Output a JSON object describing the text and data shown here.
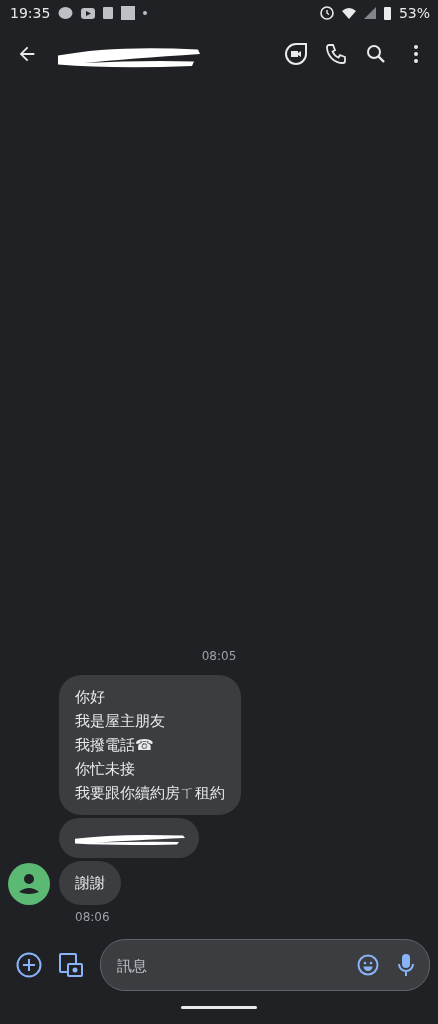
{
  "status_bar": {
    "time": "19:35",
    "battery": "53%"
  },
  "app_bar": {
    "title_redacted": true
  },
  "timestamp_top": "08:05",
  "messages": [
    {
      "kind": "text",
      "lines": [
        "你好",
        "我是屋主朋友",
        "我撥電話☎",
        "你忙未接",
        "我要跟你續約房ㄒ租約"
      ]
    },
    {
      "kind": "redacted"
    },
    {
      "kind": "text",
      "lines": [
        "謝謝"
      ],
      "avatar": true
    }
  ],
  "timestamp_bottom": "08:06",
  "composer": {
    "placeholder": "訊息"
  }
}
